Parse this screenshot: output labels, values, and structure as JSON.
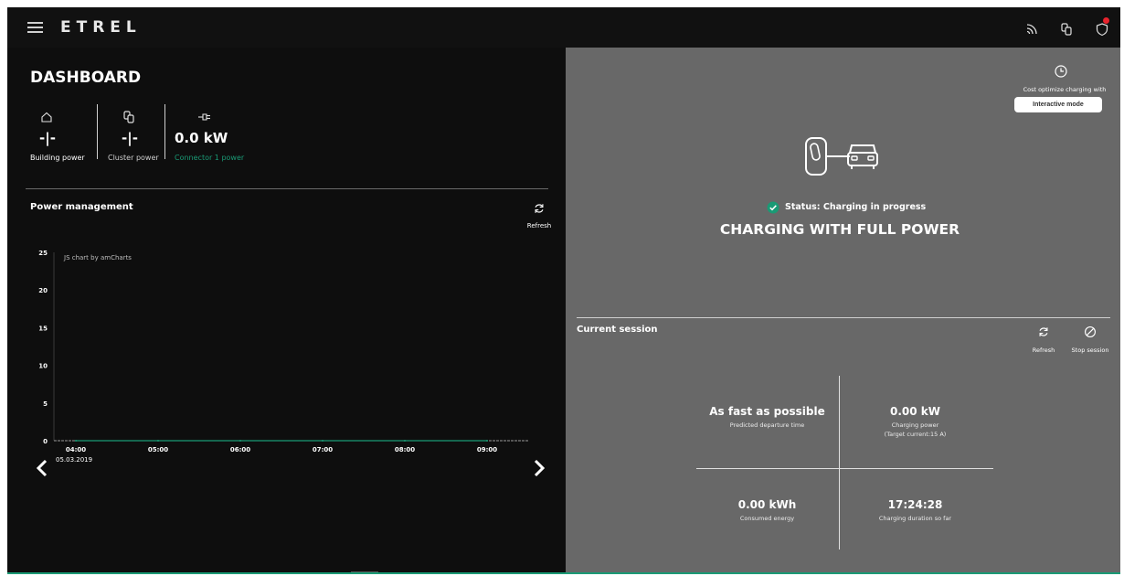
{
  "app": {
    "logo": "ETREL"
  },
  "dashboard": {
    "title": "DASHBOARD",
    "kpis": [
      {
        "value": "-|-",
        "label": "Building power",
        "icon": "home-icon",
        "label_color": "#ffffff"
      },
      {
        "value": "-|-",
        "label": "Cluster power",
        "icon": "cluster-chargers-icon",
        "label_color": "#cfcfcf"
      },
      {
        "value": "0.0 kW",
        "label": "Connector 1 power",
        "icon": "plug-icon",
        "label_color": "#1a9a75"
      }
    ]
  },
  "power_management": {
    "title": "Power management",
    "refresh_label": "Refresh",
    "credit": "JS chart by amCharts",
    "date": "05.03.2019"
  },
  "chart_data": {
    "type": "line",
    "title": "",
    "x": [
      "04:00",
      "05:00",
      "06:00",
      "07:00",
      "08:00",
      "09:00"
    ],
    "y_ticks": [
      0,
      5,
      10,
      15,
      20,
      25
    ],
    "ylim": [
      0,
      25
    ],
    "series": [
      {
        "values": [
          0,
          0,
          0,
          0,
          0,
          0
        ]
      }
    ]
  },
  "charging": {
    "cost_text": "Cost optimize charging with",
    "interactive_label": "Interactive mode",
    "status": "Status: Charging in progress",
    "big_status": "CHARGING WITH FULL POWER"
  },
  "session": {
    "title": "Current session",
    "refresh_label": "Refresh",
    "stop_label": "Stop session",
    "departure_value": "As fast as possible",
    "departure_label": "Predicted departure time",
    "power_value": "0.00 kW",
    "power_label": "Charging power",
    "power_sub": "(Target current:15 A)",
    "energy_value": "0.00 kWh",
    "energy_label": "Consumed energy",
    "duration_value": "17:24:28",
    "duration_label": "Charging duration so far"
  },
  "colors": {
    "accent": "#1a9a75",
    "notification": "#e8232d",
    "panel_dark": "#0e0e0e",
    "panel_grey": "#686868"
  }
}
